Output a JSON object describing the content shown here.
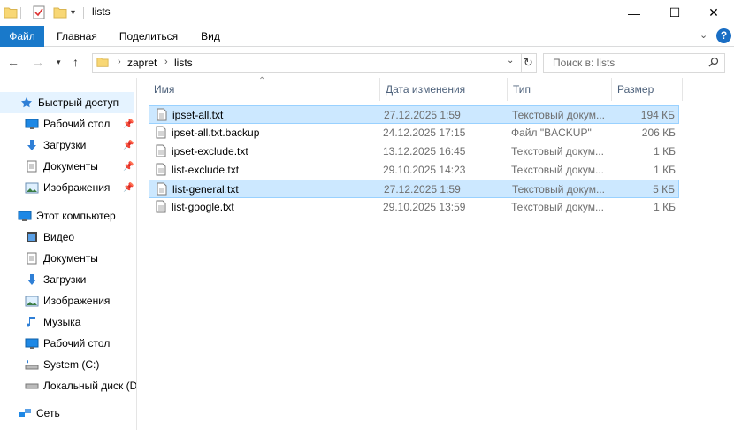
{
  "window": {
    "title": "lists",
    "minimize": "—",
    "maximize": "☐",
    "close": "✕"
  },
  "ribbon": {
    "tabs": [
      "Файл",
      "Главная",
      "Поделиться",
      "Вид"
    ],
    "help": "?"
  },
  "address": {
    "crumbs": [
      "zapret",
      "lists"
    ]
  },
  "search": {
    "placeholder": "Поиск в: lists"
  },
  "nav": {
    "quick_access": "Быстрый доступ",
    "quick_items": [
      "Рабочий стол",
      "Загрузки",
      "Документы",
      "Изображения"
    ],
    "this_pc": "Этот компьютер",
    "pc_items": [
      "Видео",
      "Документы",
      "Загрузки",
      "Изображения",
      "Музыка",
      "Рабочий стол",
      "System (C:)",
      "Локальный диск (D"
    ],
    "network": "Сеть"
  },
  "columns": [
    "Имя",
    "Дата изменения",
    "Тип",
    "Размер"
  ],
  "files": [
    {
      "name": "ipset-all.txt",
      "date": "27.12.2025 1:59",
      "type": "Текстовый докум...",
      "size": "194 КБ",
      "selected": true
    },
    {
      "name": "ipset-all.txt.backup",
      "date": "24.12.2025 17:15",
      "type": "Файл \"BACKUP\"",
      "size": "206 КБ",
      "selected": false
    },
    {
      "name": "ipset-exclude.txt",
      "date": "13.12.2025 16:45",
      "type": "Текстовый докум...",
      "size": "1 КБ",
      "selected": false
    },
    {
      "name": "list-exclude.txt",
      "date": "29.10.2025 14:23",
      "type": "Текстовый докум...",
      "size": "1 КБ",
      "selected": false
    },
    {
      "name": "list-general.txt",
      "date": "27.12.2025 1:59",
      "type": "Текстовый докум...",
      "size": "5 КБ",
      "selected": true
    },
    {
      "name": "list-google.txt",
      "date": "29.10.2025 13:59",
      "type": "Текстовый докум...",
      "size": "1 КБ",
      "selected": false
    }
  ]
}
